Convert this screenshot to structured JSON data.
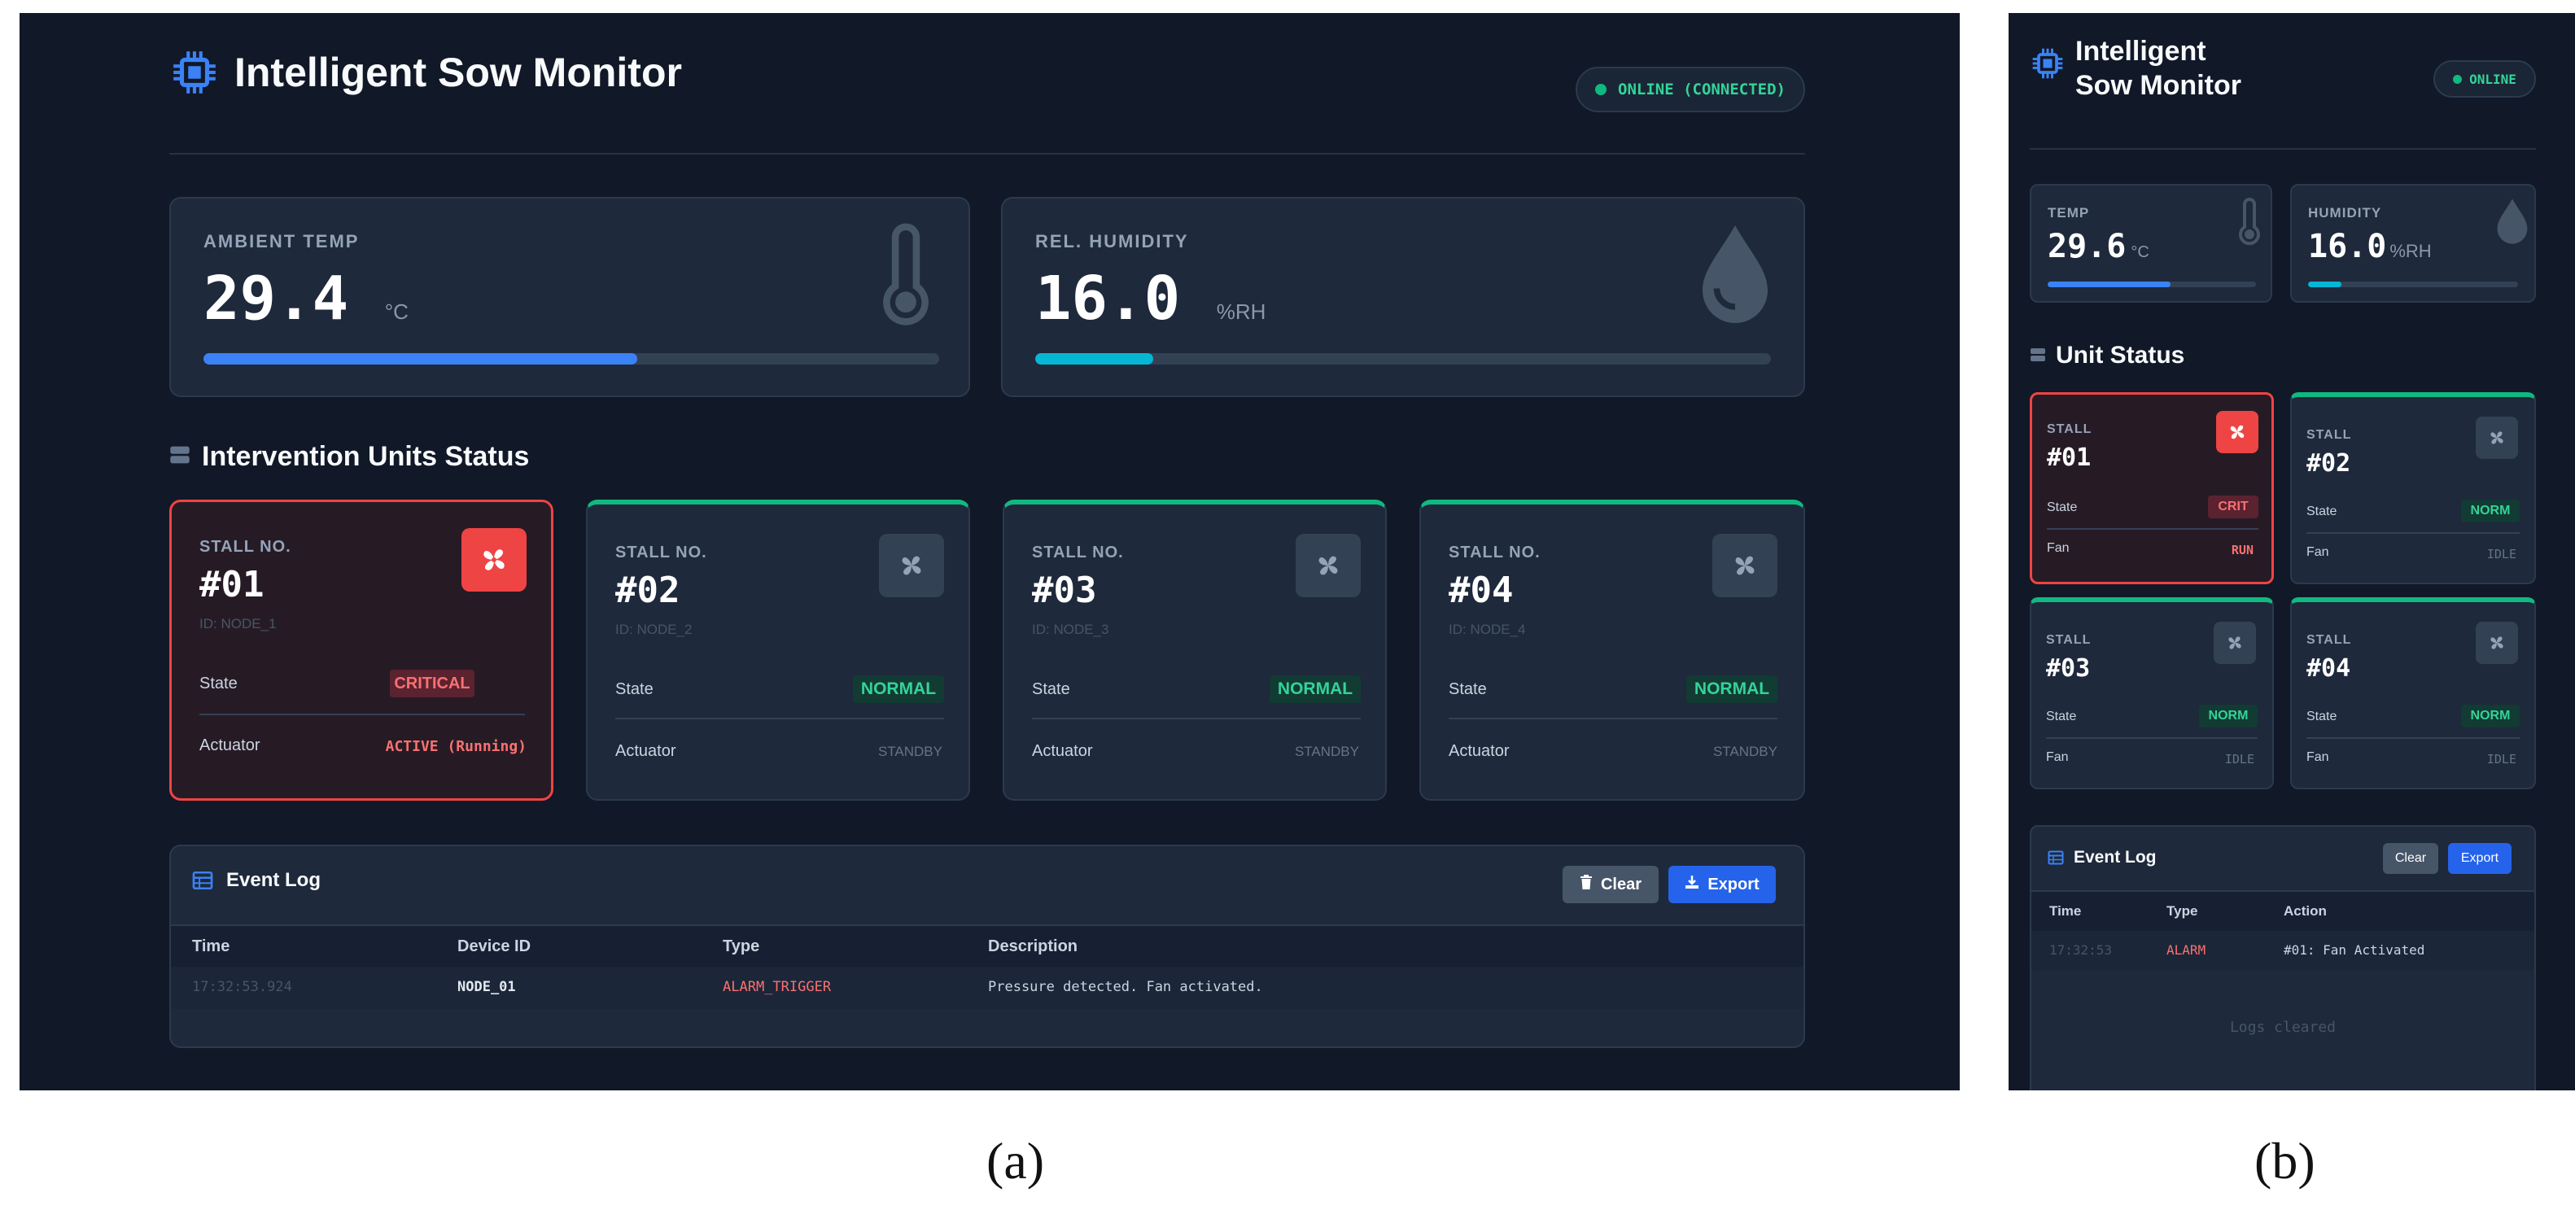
{
  "colors": {
    "background": "#111827",
    "card": "#1e293b",
    "accent_blue": "#3b82f6",
    "accent_cyan": "#06b6d4",
    "normal_green": "#10b981",
    "critical_red": "#ef4444"
  },
  "panel_a": {
    "title": "Intelligent Sow Monitor",
    "status": "ONLINE (CONNECTED)",
    "sensors": [
      {
        "label": "AMBIENT TEMP",
        "value": "29.4",
        "unit": "°C",
        "level": 0.59,
        "icon": "thermometer-icon"
      },
      {
        "label": "REL. HUMIDITY",
        "value": "16.0",
        "unit": "%RH",
        "level": 0.16,
        "icon": "droplet-icon"
      }
    ],
    "units_heading": "Intervention Units Status",
    "stalls": [
      {
        "label": "STALL NO.",
        "number": "#01",
        "id": "ID: NODE_1",
        "state_label": "State",
        "state": "CRITICAL",
        "actuator_label": "Actuator",
        "actuator": "ACTIVE (Running)"
      },
      {
        "label": "STALL NO.",
        "number": "#02",
        "id": "ID: NODE_2",
        "state_label": "State",
        "state": "NORMAL",
        "actuator_label": "Actuator",
        "actuator": "STANDBY"
      },
      {
        "label": "STALL NO.",
        "number": "#03",
        "id": "ID: NODE_3",
        "state_label": "State",
        "state": "NORMAL",
        "actuator_label": "Actuator",
        "actuator": "STANDBY"
      },
      {
        "label": "STALL NO.",
        "number": "#04",
        "id": "ID: NODE_4",
        "state_label": "State",
        "state": "NORMAL",
        "actuator_label": "Actuator",
        "actuator": "STANDBY"
      }
    ],
    "log": {
      "title": "Event Log",
      "clear": "Clear",
      "export": "Export",
      "columns": [
        "Time",
        "Device ID",
        "Type",
        "Description"
      ],
      "rows": [
        {
          "time": "17:32:53.924",
          "device": "NODE_01",
          "type": "ALARM_TRIGGER",
          "description": "Pressure detected. Fan activated."
        }
      ]
    }
  },
  "panel_b": {
    "title_line1": "Intelligent",
    "title_line2": "Sow Monitor",
    "status": "ONLINE",
    "sensors": [
      {
        "label": "TEMP",
        "value": "29.6",
        "unit": "°C",
        "level": 0.59,
        "icon": "thermometer-icon"
      },
      {
        "label": "HUMIDITY",
        "value": "16.0",
        "unit": "%RH",
        "level": 0.16,
        "icon": "droplet-icon"
      }
    ],
    "units_heading": "Unit Status",
    "stalls": [
      {
        "label": "STALL",
        "number": "#01",
        "state_label": "State",
        "state": "CRIT",
        "fan_label": "Fan",
        "fan": "RUN"
      },
      {
        "label": "STALL",
        "number": "#02",
        "state_label": "State",
        "state": "NORM",
        "fan_label": "Fan",
        "fan": "IDLE"
      },
      {
        "label": "STALL",
        "number": "#03",
        "state_label": "State",
        "state": "NORM",
        "fan_label": "Fan",
        "fan": "IDLE"
      },
      {
        "label": "STALL",
        "number": "#04",
        "state_label": "State",
        "state": "NORM",
        "fan_label": "Fan",
        "fan": "IDLE"
      }
    ],
    "log": {
      "title": "Event Log",
      "clear": "Clear",
      "export": "Export",
      "columns": [
        "Time",
        "Type",
        "Action"
      ],
      "rows": [
        {
          "time": "17:32:53",
          "type": "ALARM",
          "action": "#01: Fan Activated"
        }
      ],
      "empty_note": "Logs cleared"
    }
  },
  "captions": {
    "a": "(a)",
    "b": "(b)"
  }
}
